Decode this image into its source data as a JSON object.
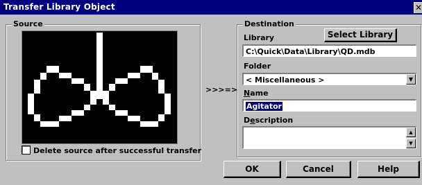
{
  "window": {
    "title": "Transfer Library Object"
  },
  "source": {
    "legend": "Source",
    "delete_checkbox_label": "Delete source after successful transfer",
    "delete_checked": false
  },
  "arrow": ">>>=>",
  "destination": {
    "legend": "Destination",
    "library_label": "Library",
    "select_library_button": "Select Library",
    "library_path": "C:\\Quick\\Data\\Library\\QD.mdb",
    "folder_label": "Folder",
    "folder_value": "< Miscellaneous >",
    "name_label": "Name",
    "name_value": "Agitator",
    "description_label": "Description",
    "description_value": ""
  },
  "buttons": {
    "ok": "OK",
    "cancel": "Cancel",
    "help": "Help"
  },
  "icons": {
    "close": "close-icon",
    "dropdown": "chevron-down-icon"
  }
}
